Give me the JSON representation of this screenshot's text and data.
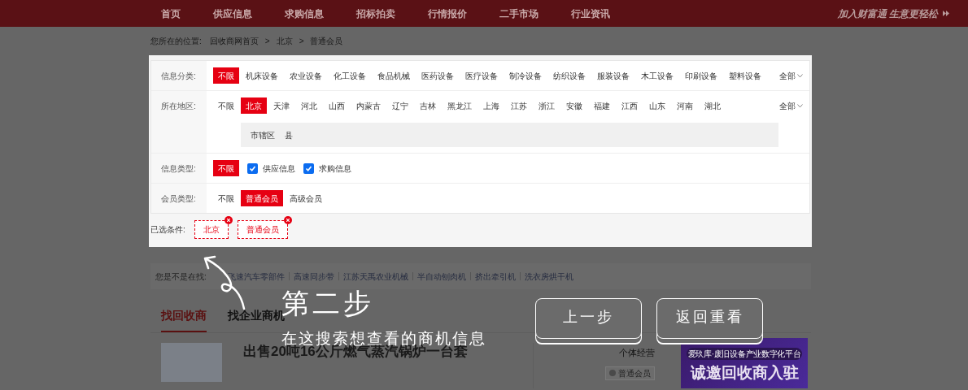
{
  "nav": {
    "items": [
      {
        "label": "首页"
      },
      {
        "label": "供应信息"
      },
      {
        "label": "求购信息"
      },
      {
        "label": "招标拍卖"
      },
      {
        "label": "行情报价"
      },
      {
        "label": "二手市场"
      },
      {
        "label": "行业资讯"
      }
    ],
    "slogan": "加入财富通 生意更轻松"
  },
  "breadcrumb": {
    "prefix": "您所在的位置:",
    "separator": ">",
    "items": [
      "回收商网首页",
      "北京",
      "普通会员"
    ]
  },
  "filters": [
    {
      "label": "信息分类:",
      "kind": "chips",
      "more": "全部",
      "options": [
        {
          "label": "不限",
          "selected": true
        },
        {
          "label": "机床设备",
          "selected": false
        },
        {
          "label": "农业设备",
          "selected": false
        },
        {
          "label": "化工设备",
          "selected": false
        },
        {
          "label": "食品机械",
          "selected": false
        },
        {
          "label": "医药设备",
          "selected": false
        },
        {
          "label": "医疗设备",
          "selected": false
        },
        {
          "label": "制冷设备",
          "selected": false
        },
        {
          "label": "纺织设备",
          "selected": false
        },
        {
          "label": "服装设备",
          "selected": false
        },
        {
          "label": "木工设备",
          "selected": false
        },
        {
          "label": "印刷设备",
          "selected": false
        },
        {
          "label": "塑料设备",
          "selected": false
        }
      ]
    },
    {
      "label": "所在地区:",
      "kind": "chips",
      "more": "全部",
      "options": [
        {
          "label": "不限",
          "selected": false
        },
        {
          "label": "北京",
          "selected": true
        },
        {
          "label": "天津",
          "selected": false
        },
        {
          "label": "河北",
          "selected": false
        },
        {
          "label": "山西",
          "selected": false
        },
        {
          "label": "内蒙古",
          "selected": false
        },
        {
          "label": "辽宁",
          "selected": false
        },
        {
          "label": "吉林",
          "selected": false
        },
        {
          "label": "黑龙江",
          "selected": false
        },
        {
          "label": "上海",
          "selected": false
        },
        {
          "label": "江苏",
          "selected": false
        },
        {
          "label": "浙江",
          "selected": false
        },
        {
          "label": "安徽",
          "selected": false
        },
        {
          "label": "福建",
          "selected": false
        },
        {
          "label": "江西",
          "selected": false
        },
        {
          "label": "山东",
          "selected": false
        },
        {
          "label": "河南",
          "selected": false
        },
        {
          "label": "湖北",
          "selected": false
        }
      ],
      "sub_options": [
        "市辖区",
        "县"
      ]
    },
    {
      "label": "信息类型:",
      "kind": "checks",
      "options": [
        {
          "label": "不限",
          "selected": true
        }
      ],
      "checks": [
        {
          "label": "供应信息",
          "checked": true
        },
        {
          "label": "求购信息",
          "checked": true
        }
      ]
    },
    {
      "label": "会员类型:",
      "kind": "chips",
      "options": [
        {
          "label": "不限",
          "selected": false
        },
        {
          "label": "普通会员",
          "selected": true
        },
        {
          "label": "高级会员",
          "selected": false
        }
      ]
    }
  ],
  "selected_conditions": {
    "label": "已选条件:",
    "tags": [
      "北京",
      "普通会员"
    ]
  },
  "suggestions": {
    "label": "您是不是在找:",
    "items": [
      "飞速汽车零部件",
      "高速同步带",
      "江苏天禹农业机械",
      "半自动刨肉机",
      "挤出牵引机",
      "洗衣房烘干机"
    ]
  },
  "tabs": [
    {
      "label": "找回收商",
      "selected": true
    },
    {
      "label": "找企业商机",
      "selected": false
    }
  ],
  "listing": {
    "title": "出售20吨16公斤燃气蒸汽锅炉一台套",
    "business_type": "个体经营",
    "member_badge": "普通会员"
  },
  "ad": {
    "tagline": "爱玖库·废旧设备产业数字化平台",
    "headline": "诚邀回收商入驻"
  },
  "guide": {
    "step": "第二步",
    "hint": "在这搜索想查看的商机信息",
    "buttons": [
      "上一步",
      "返回重看"
    ]
  }
}
